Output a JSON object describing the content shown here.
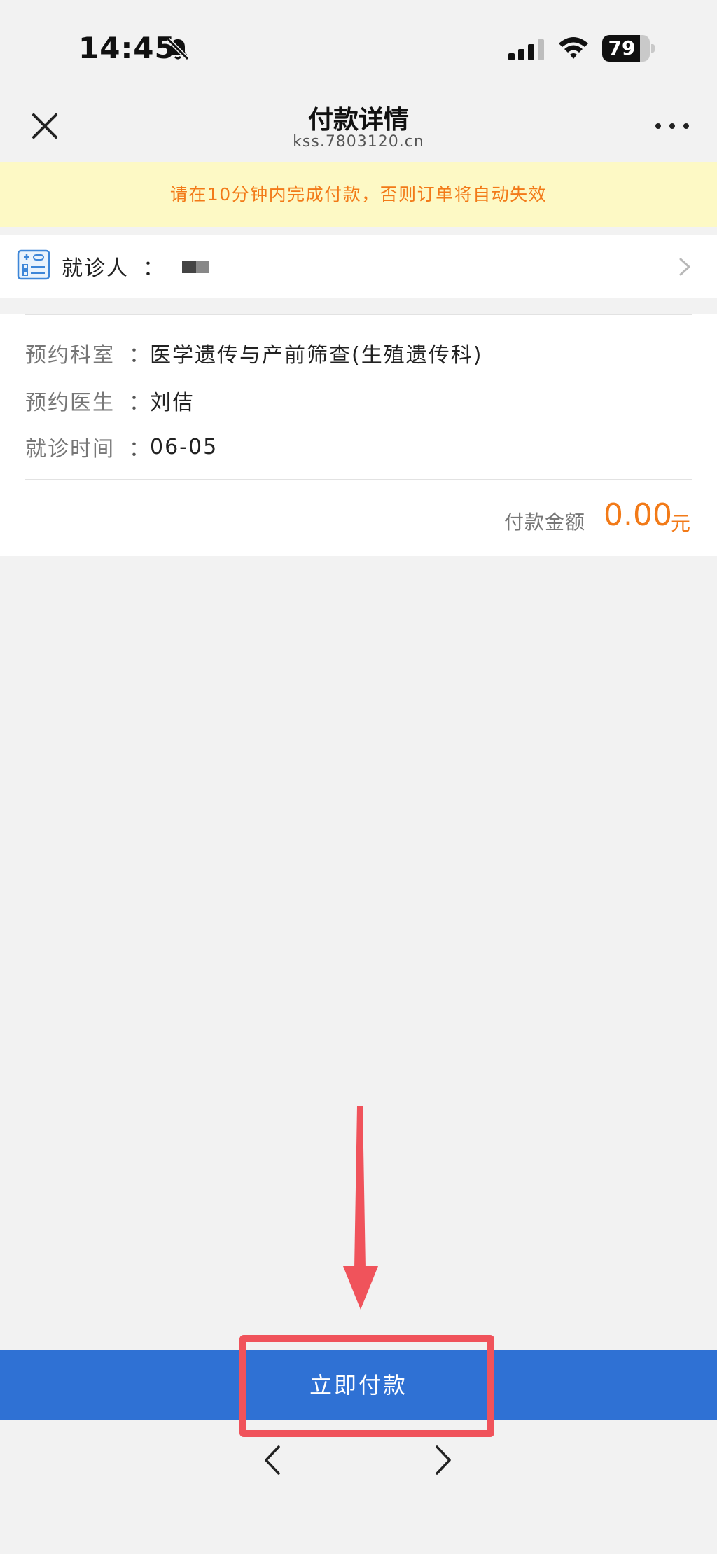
{
  "status_bar": {
    "time": "14:45",
    "battery_level": "79",
    "battery_fraction": 0.79,
    "icons": [
      "bell-slash-icon",
      "signal-icon",
      "wifi-icon",
      "battery-icon"
    ]
  },
  "nav": {
    "title": "付款详情",
    "subtitle": "kss.7803120.cn",
    "close_icon": "close-icon",
    "more_icon": "more-icon"
  },
  "notice": {
    "text": "请在10分钟内完成付款，否则订单将自动失效"
  },
  "patient": {
    "icon": "medical-card-icon",
    "label": "就诊人",
    "colon": "："
  },
  "details": [
    {
      "label": "预约科室",
      "colon": "：",
      "value": "医学遗传与产前筛查(生殖遗传科)"
    },
    {
      "label": "预约医生",
      "colon": "：",
      "value": "刘佶"
    },
    {
      "label": "就诊时间",
      "colon": "：",
      "value": "06-05"
    }
  ],
  "amount": {
    "label": "付款金额",
    "value": "0.00",
    "unit": "元"
  },
  "pay_button": {
    "label": "立即付款"
  },
  "colors": {
    "accent_blue": "#2f71d4",
    "warning_orange": "#f27a18",
    "notice_bg": "#fdf9c5",
    "annotation_red": "#f0535b"
  }
}
